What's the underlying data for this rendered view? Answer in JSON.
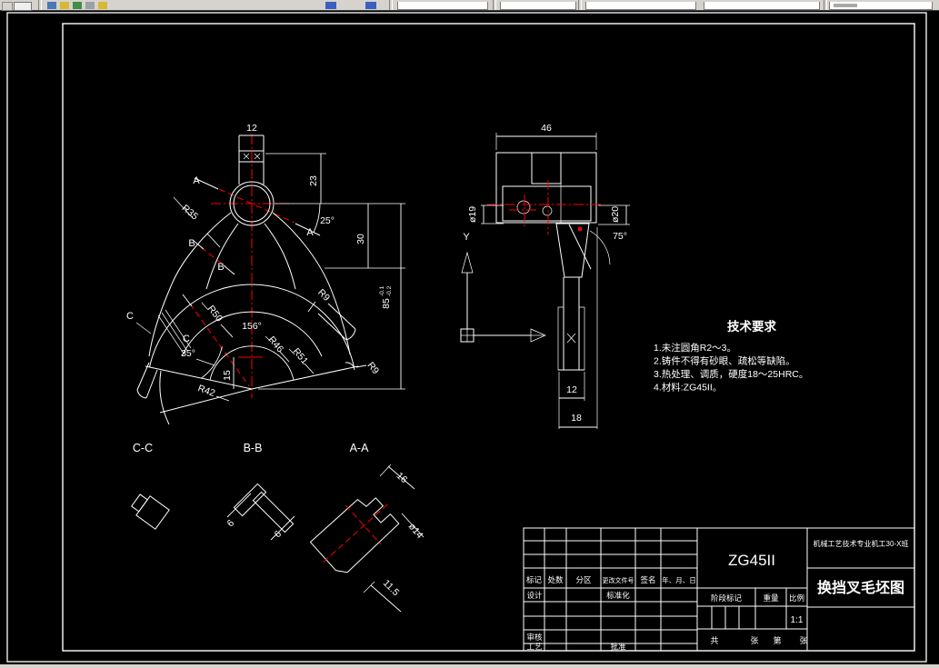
{
  "front_view": {
    "dim_12": "12",
    "dim_23": "23",
    "angle_25": "25°",
    "dim_30": "30",
    "dim_85": "85",
    "dim_85_tol_upper": "-0.1",
    "dim_85_tol_lower": "-0.2",
    "angle_156": "156°",
    "angle_35": "35°",
    "dim_15": "15",
    "radius_r35": "R35",
    "radius_r50": "R50",
    "radius_r46": "R46",
    "radius_r51": "R51",
    "radius_r42": "R42",
    "radius_r9_top": "R9",
    "radius_r9_right": "R9",
    "label_a1": "A",
    "label_a2": "A",
    "label_b1": "B",
    "label_b2": "B",
    "label_c1": "C",
    "label_c2": "C"
  },
  "side_view": {
    "dim_46": "46",
    "dim_d19": "ø19",
    "dim_d20": "ø20",
    "angle_75": "75°",
    "dim_12": "12",
    "dim_18": "18",
    "ucs_y_label": "Y"
  },
  "section_views": {
    "cc_label": "C-C",
    "bb_label": "B-B",
    "aa_label": "A-A",
    "bb_dim_6a": "6",
    "bb_dim_6b": "6",
    "aa_dim_16": "16",
    "aa_dim_d14": "ø14",
    "aa_dim_11_5": "11.5"
  },
  "tech_requirements": {
    "title": "技术要求",
    "items": [
      "1.未注圆角R2～3。",
      "2.铸件不得有砂眼、疏松等缺陷。",
      "3.热处理、调质，硬度18～25HRC。",
      "4.材料:ZG45II。"
    ]
  },
  "title_block": {
    "material": "ZG45II",
    "org": "机械工艺技术专业机工30-X班",
    "drawing_title": "换挡叉毛坯图",
    "col_headers": [
      "标记",
      "处数",
      "分区",
      "更改文件号",
      "签名",
      "年、月、日"
    ],
    "row_design": "设计",
    "row_standard": "标准化",
    "row_check": "审核",
    "row_process": "工艺",
    "row_approve": "批准",
    "stage_mark": "阶段标记",
    "weight": "重量",
    "scale_label": "比例",
    "scale_value": "1:1",
    "sheet_labels": [
      "共",
      "张",
      "第",
      "张"
    ]
  },
  "colors": {
    "line": "#ffffff",
    "centerline": "#ff0000",
    "background": "#000000",
    "toolbar": "#d6d3ce"
  }
}
